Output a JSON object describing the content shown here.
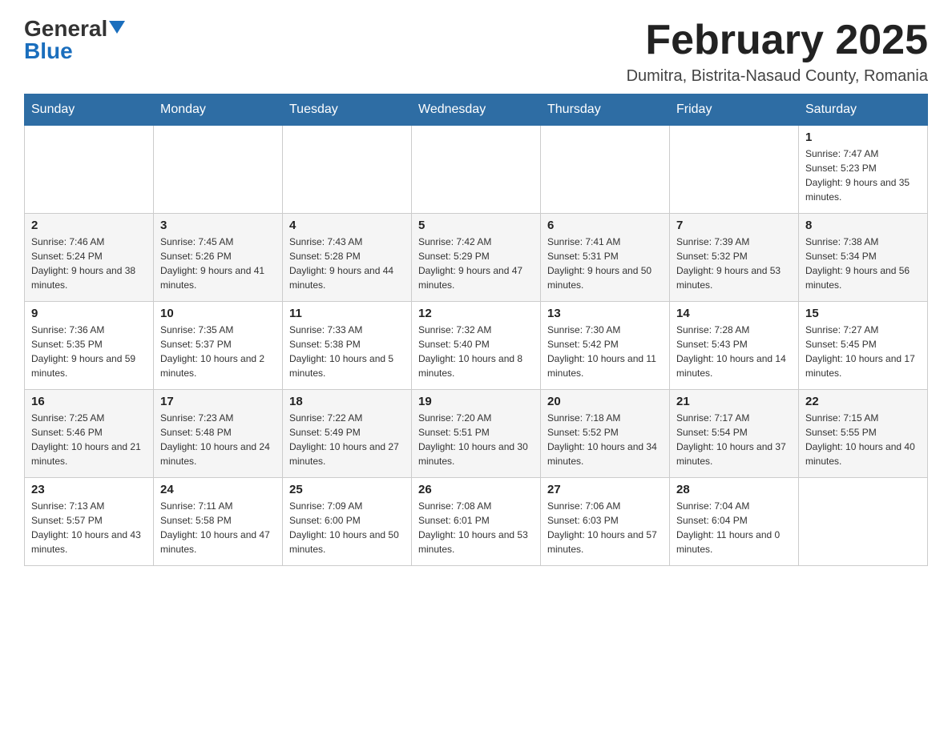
{
  "header": {
    "logo_general": "General",
    "logo_blue": "Blue",
    "month_title": "February 2025",
    "location": "Dumitra, Bistrita-Nasaud County, Romania"
  },
  "days_of_week": [
    "Sunday",
    "Monday",
    "Tuesday",
    "Wednesday",
    "Thursday",
    "Friday",
    "Saturday"
  ],
  "weeks": [
    [
      {
        "day": "",
        "info": ""
      },
      {
        "day": "",
        "info": ""
      },
      {
        "day": "",
        "info": ""
      },
      {
        "day": "",
        "info": ""
      },
      {
        "day": "",
        "info": ""
      },
      {
        "day": "",
        "info": ""
      },
      {
        "day": "1",
        "info": "Sunrise: 7:47 AM\nSunset: 5:23 PM\nDaylight: 9 hours and 35 minutes."
      }
    ],
    [
      {
        "day": "2",
        "info": "Sunrise: 7:46 AM\nSunset: 5:24 PM\nDaylight: 9 hours and 38 minutes."
      },
      {
        "day": "3",
        "info": "Sunrise: 7:45 AM\nSunset: 5:26 PM\nDaylight: 9 hours and 41 minutes."
      },
      {
        "day": "4",
        "info": "Sunrise: 7:43 AM\nSunset: 5:28 PM\nDaylight: 9 hours and 44 minutes."
      },
      {
        "day": "5",
        "info": "Sunrise: 7:42 AM\nSunset: 5:29 PM\nDaylight: 9 hours and 47 minutes."
      },
      {
        "day": "6",
        "info": "Sunrise: 7:41 AM\nSunset: 5:31 PM\nDaylight: 9 hours and 50 minutes."
      },
      {
        "day": "7",
        "info": "Sunrise: 7:39 AM\nSunset: 5:32 PM\nDaylight: 9 hours and 53 minutes."
      },
      {
        "day": "8",
        "info": "Sunrise: 7:38 AM\nSunset: 5:34 PM\nDaylight: 9 hours and 56 minutes."
      }
    ],
    [
      {
        "day": "9",
        "info": "Sunrise: 7:36 AM\nSunset: 5:35 PM\nDaylight: 9 hours and 59 minutes."
      },
      {
        "day": "10",
        "info": "Sunrise: 7:35 AM\nSunset: 5:37 PM\nDaylight: 10 hours and 2 minutes."
      },
      {
        "day": "11",
        "info": "Sunrise: 7:33 AM\nSunset: 5:38 PM\nDaylight: 10 hours and 5 minutes."
      },
      {
        "day": "12",
        "info": "Sunrise: 7:32 AM\nSunset: 5:40 PM\nDaylight: 10 hours and 8 minutes."
      },
      {
        "day": "13",
        "info": "Sunrise: 7:30 AM\nSunset: 5:42 PM\nDaylight: 10 hours and 11 minutes."
      },
      {
        "day": "14",
        "info": "Sunrise: 7:28 AM\nSunset: 5:43 PM\nDaylight: 10 hours and 14 minutes."
      },
      {
        "day": "15",
        "info": "Sunrise: 7:27 AM\nSunset: 5:45 PM\nDaylight: 10 hours and 17 minutes."
      }
    ],
    [
      {
        "day": "16",
        "info": "Sunrise: 7:25 AM\nSunset: 5:46 PM\nDaylight: 10 hours and 21 minutes."
      },
      {
        "day": "17",
        "info": "Sunrise: 7:23 AM\nSunset: 5:48 PM\nDaylight: 10 hours and 24 minutes."
      },
      {
        "day": "18",
        "info": "Sunrise: 7:22 AM\nSunset: 5:49 PM\nDaylight: 10 hours and 27 minutes."
      },
      {
        "day": "19",
        "info": "Sunrise: 7:20 AM\nSunset: 5:51 PM\nDaylight: 10 hours and 30 minutes."
      },
      {
        "day": "20",
        "info": "Sunrise: 7:18 AM\nSunset: 5:52 PM\nDaylight: 10 hours and 34 minutes."
      },
      {
        "day": "21",
        "info": "Sunrise: 7:17 AM\nSunset: 5:54 PM\nDaylight: 10 hours and 37 minutes."
      },
      {
        "day": "22",
        "info": "Sunrise: 7:15 AM\nSunset: 5:55 PM\nDaylight: 10 hours and 40 minutes."
      }
    ],
    [
      {
        "day": "23",
        "info": "Sunrise: 7:13 AM\nSunset: 5:57 PM\nDaylight: 10 hours and 43 minutes."
      },
      {
        "day": "24",
        "info": "Sunrise: 7:11 AM\nSunset: 5:58 PM\nDaylight: 10 hours and 47 minutes."
      },
      {
        "day": "25",
        "info": "Sunrise: 7:09 AM\nSunset: 6:00 PM\nDaylight: 10 hours and 50 minutes."
      },
      {
        "day": "26",
        "info": "Sunrise: 7:08 AM\nSunset: 6:01 PM\nDaylight: 10 hours and 53 minutes."
      },
      {
        "day": "27",
        "info": "Sunrise: 7:06 AM\nSunset: 6:03 PM\nDaylight: 10 hours and 57 minutes."
      },
      {
        "day": "28",
        "info": "Sunrise: 7:04 AM\nSunset: 6:04 PM\nDaylight: 11 hours and 0 minutes."
      },
      {
        "day": "",
        "info": ""
      }
    ]
  ]
}
